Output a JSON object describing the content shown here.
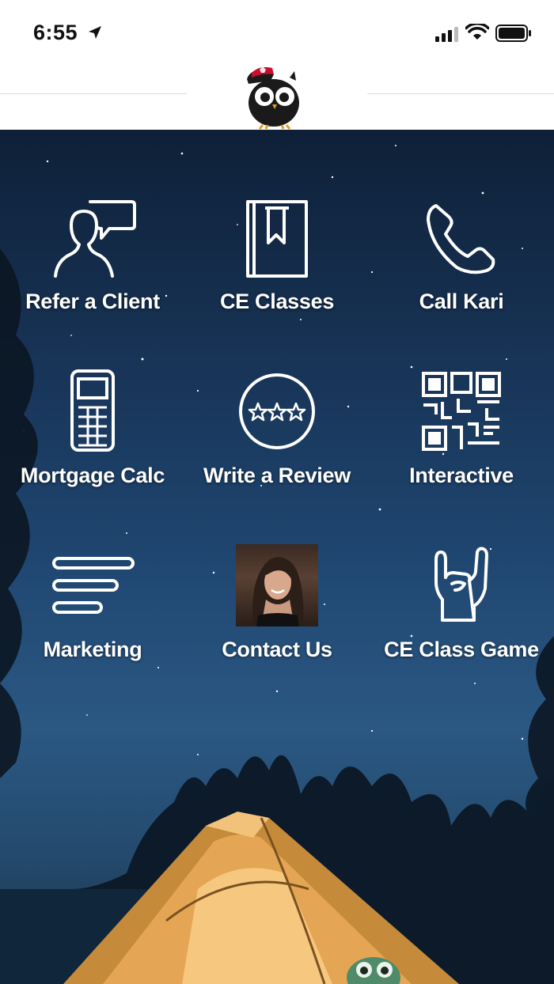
{
  "status_bar": {
    "time": "6:55"
  },
  "tiles": [
    {
      "label": "Refer a Client",
      "icon": "person-speech-icon"
    },
    {
      "label": "CE Classes",
      "icon": "book-icon"
    },
    {
      "label": "Call Kari",
      "icon": "phone-icon"
    },
    {
      "label": "Mortgage Calc",
      "icon": "calculator-icon"
    },
    {
      "label": "Write a Review",
      "icon": "stars-icon"
    },
    {
      "label": "Interactive",
      "icon": "qr-code-icon"
    },
    {
      "label": "Marketing",
      "icon": "bars-icon"
    },
    {
      "label": "Contact Us",
      "icon": "profile-photo"
    },
    {
      "label": "CE Class Game",
      "icon": "rock-hand-icon"
    }
  ],
  "colors": {
    "header_bg": "#ffffff",
    "label_color": "#ffffff",
    "sky_top": "#0e2037",
    "sky_mid": "#1f4670"
  }
}
